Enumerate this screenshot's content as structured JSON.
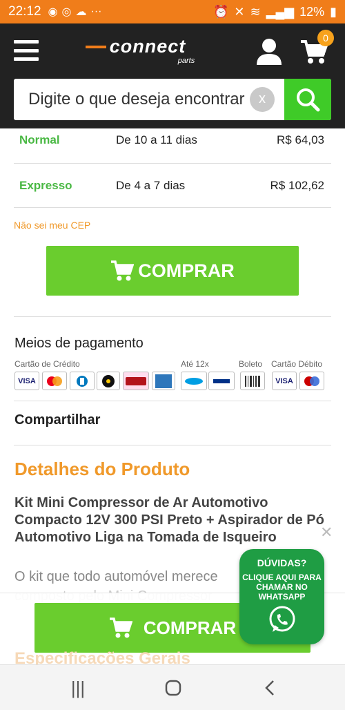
{
  "status_bar": {
    "time": "22:12",
    "battery": "12%",
    "dots": "···"
  },
  "header": {
    "logo_text": "connect",
    "logo_sub": "parts",
    "cart_count": "0"
  },
  "search": {
    "placeholder": "Digite o que deseja encontrar",
    "clear_label": "x"
  },
  "shipping": [
    {
      "type": "Normal",
      "days": "De 10 a 11 dias",
      "price": "R$ 64,03"
    },
    {
      "type": "Expresso",
      "days": "De 4 a 7 dias",
      "price": "R$ 102,62"
    }
  ],
  "no_cep_label": "Não sei meu CEP",
  "buy_label": "COMPRAR",
  "payment": {
    "title": "Meios de pagamento",
    "credit_label": "Cartão de Crédito",
    "installments_label": "Até 12x",
    "boleto_label": "Boleto",
    "debit_label": "Cartão Débito",
    "cards": [
      "VISA",
      "Mastercard",
      "Diners",
      "Elo",
      "Hipercard",
      "Amex",
      "MercadoPago",
      "PayPal",
      "Boleto",
      "VISA",
      "Maestro"
    ]
  },
  "share_label": "Compartilhar",
  "details": {
    "title": "Detalhes do Produto",
    "product_title": "Kit Mini Compressor de Ar Automotivo Compacto 12V 300 PSI Preto + Aspirador de Pó Automotivo Liga na Tomada de Isqueiro",
    "desc_line1": "O kit que todo automóvel merece",
    "desc_line2": "composto pelo Mini Compressor",
    "next_heading": "Especificações Gerais"
  },
  "whatsapp": {
    "question": "DÚVIDAS?",
    "text": "CLIQUE AQUI PARA CHAMAR NO WHATSAPP"
  },
  "colors": {
    "status_bar": "#f07d1a",
    "header": "#222222",
    "accent_green": "#6acd2e",
    "search_green": "#3fcb28",
    "orange_text": "#f0992a",
    "whatsapp": "#1f9d44"
  }
}
